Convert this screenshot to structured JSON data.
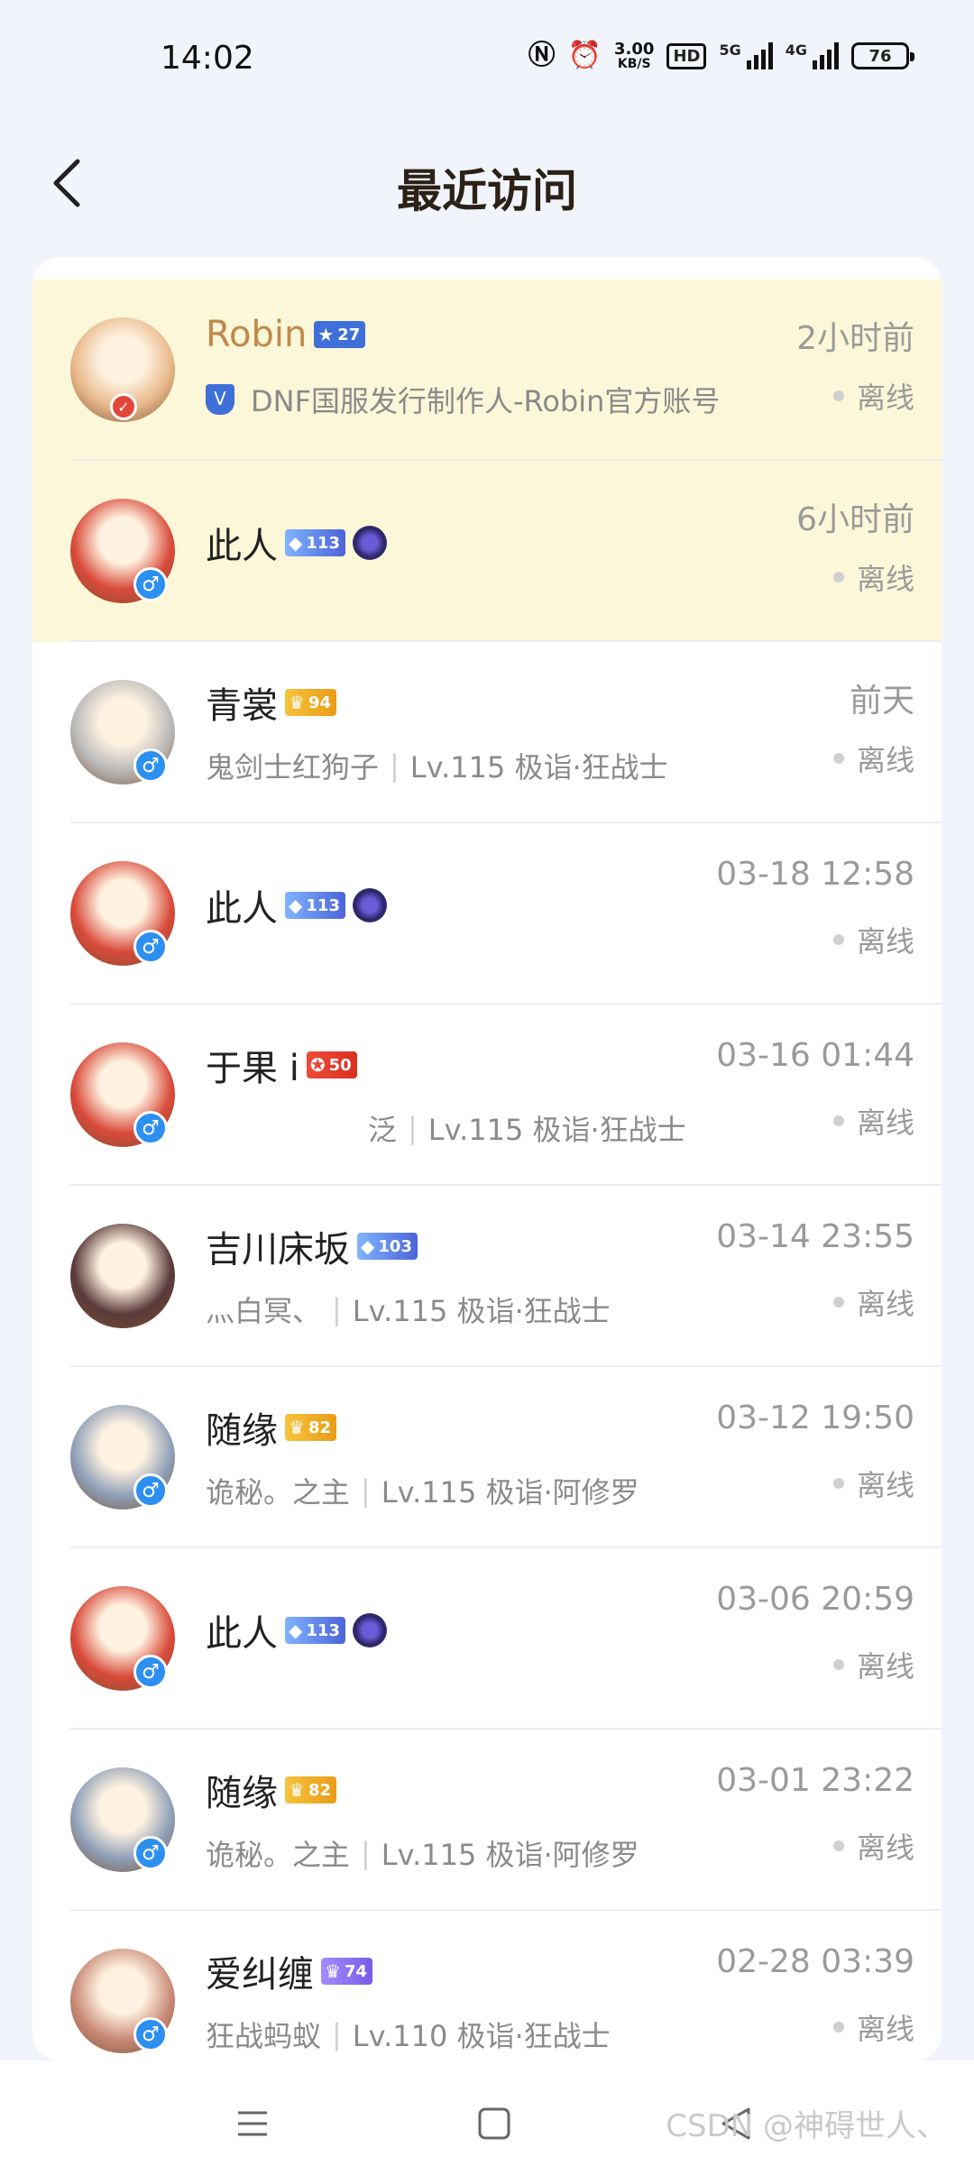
{
  "status_bar": {
    "time": "14:02",
    "net_speed_value": "3.00",
    "net_speed_unit": "KB/S",
    "hd_label": "HD",
    "net1": "5G",
    "net2": "4G",
    "battery": "76"
  },
  "header": {
    "title": "最近访问"
  },
  "visitors": [
    {
      "name": "Robin",
      "name_style": "gold",
      "badge_type": "blue",
      "badge_icon": "★",
      "badge_level": "27",
      "emblem": false,
      "avatar_color": "#e8b88a",
      "gender": "",
      "verified": true,
      "official": true,
      "subtitle": "DNF国服发行制作人-Robin官方账号",
      "time": "2小时前",
      "status": "离线",
      "highlight": true
    },
    {
      "name": "此人",
      "name_style": "",
      "badge_type": "diamond",
      "badge_icon": "◆",
      "badge_level": "113",
      "emblem": true,
      "avatar_color": "#d94a3a",
      "gender": "♂",
      "verified": false,
      "official": false,
      "subtitle": "",
      "time": "6小时前",
      "status": "离线",
      "highlight": true
    },
    {
      "name": "青裳",
      "name_style": "",
      "badge_type": "gold",
      "badge_icon": "♛",
      "badge_level": "94",
      "emblem": false,
      "avatar_color": "#b9b9b9",
      "gender": "♂",
      "verified": false,
      "official": false,
      "subtitle_left": "鬼剑士红狗子",
      "subtitle_right": "Lv.115 极诣·狂战士",
      "time": "前天",
      "status": "离线",
      "highlight": false
    },
    {
      "name": "此人",
      "name_style": "",
      "badge_type": "diamond",
      "badge_icon": "◆",
      "badge_level": "113",
      "emblem": true,
      "avatar_color": "#d94a3a",
      "gender": "♂",
      "verified": false,
      "official": false,
      "subtitle": "",
      "time": "03-18 12:58",
      "status": "离线",
      "highlight": false
    },
    {
      "name": "于果 i",
      "name_style": "",
      "badge_type": "red",
      "badge_icon": "✪",
      "badge_level": "50",
      "emblem": false,
      "avatar_color": "#d94a3a",
      "gender": "♂",
      "verified": false,
      "official": false,
      "subtitle_left": "泛",
      "subtitle_right": "Lv.115 极诣·狂战士",
      "subtitle_indent": true,
      "time": "03-16 01:44",
      "status": "离线",
      "highlight": false
    },
    {
      "name": "吉川床坂",
      "name_style": "",
      "badge_type": "diamond",
      "badge_icon": "◆",
      "badge_level": "103",
      "emblem": false,
      "avatar_color": "#5a3a3a",
      "gender": "",
      "verified": false,
      "official": false,
      "subtitle_left": "灬白冥、",
      "subtitle_right": "Lv.115 极诣·狂战士",
      "time": "03-14 23:55",
      "status": "离线",
      "highlight": false
    },
    {
      "name": "随缘",
      "name_style": "",
      "badge_type": "gold",
      "badge_icon": "♛",
      "badge_level": "82",
      "emblem": false,
      "avatar_color": "#8fa0b8",
      "gender": "♂",
      "verified": false,
      "official": false,
      "subtitle_left": "诡秘。之主",
      "subtitle_right": "Lv.115 极诣·阿修罗",
      "time": "03-12 19:50",
      "status": "离线",
      "highlight": false
    },
    {
      "name": "此人",
      "name_style": "",
      "badge_type": "diamond",
      "badge_icon": "◆",
      "badge_level": "113",
      "emblem": true,
      "avatar_color": "#d94a3a",
      "gender": "♂",
      "verified": false,
      "official": false,
      "subtitle": "",
      "time": "03-06 20:59",
      "status": "离线",
      "highlight": false
    },
    {
      "name": "随缘",
      "name_style": "",
      "badge_type": "gold",
      "badge_icon": "♛",
      "badge_level": "82",
      "emblem": false,
      "avatar_color": "#8fa0b8",
      "gender": "♂",
      "verified": false,
      "official": false,
      "subtitle_left": "诡秘。之主",
      "subtitle_right": "Lv.115 极诣·阿修罗",
      "time": "03-01 23:22",
      "status": "离线",
      "highlight": false
    },
    {
      "name": "爱纠缠",
      "name_style": "",
      "badge_type": "purple",
      "badge_icon": "♛",
      "badge_level": "74",
      "emblem": false,
      "avatar_color": "#c98a78",
      "gender": "♂",
      "verified": false,
      "official": false,
      "subtitle_left": "狂战蚂蚁",
      "subtitle_right": "Lv.110 极诣·狂战士",
      "time": "02-28 03:39",
      "status": "离线",
      "highlight": false
    }
  ],
  "nav": {
    "menu_icon": "menu-icon",
    "home_icon": "home-icon",
    "back_icon": "back-triangle-icon"
  },
  "watermark": "CSDN @神碍世人、"
}
